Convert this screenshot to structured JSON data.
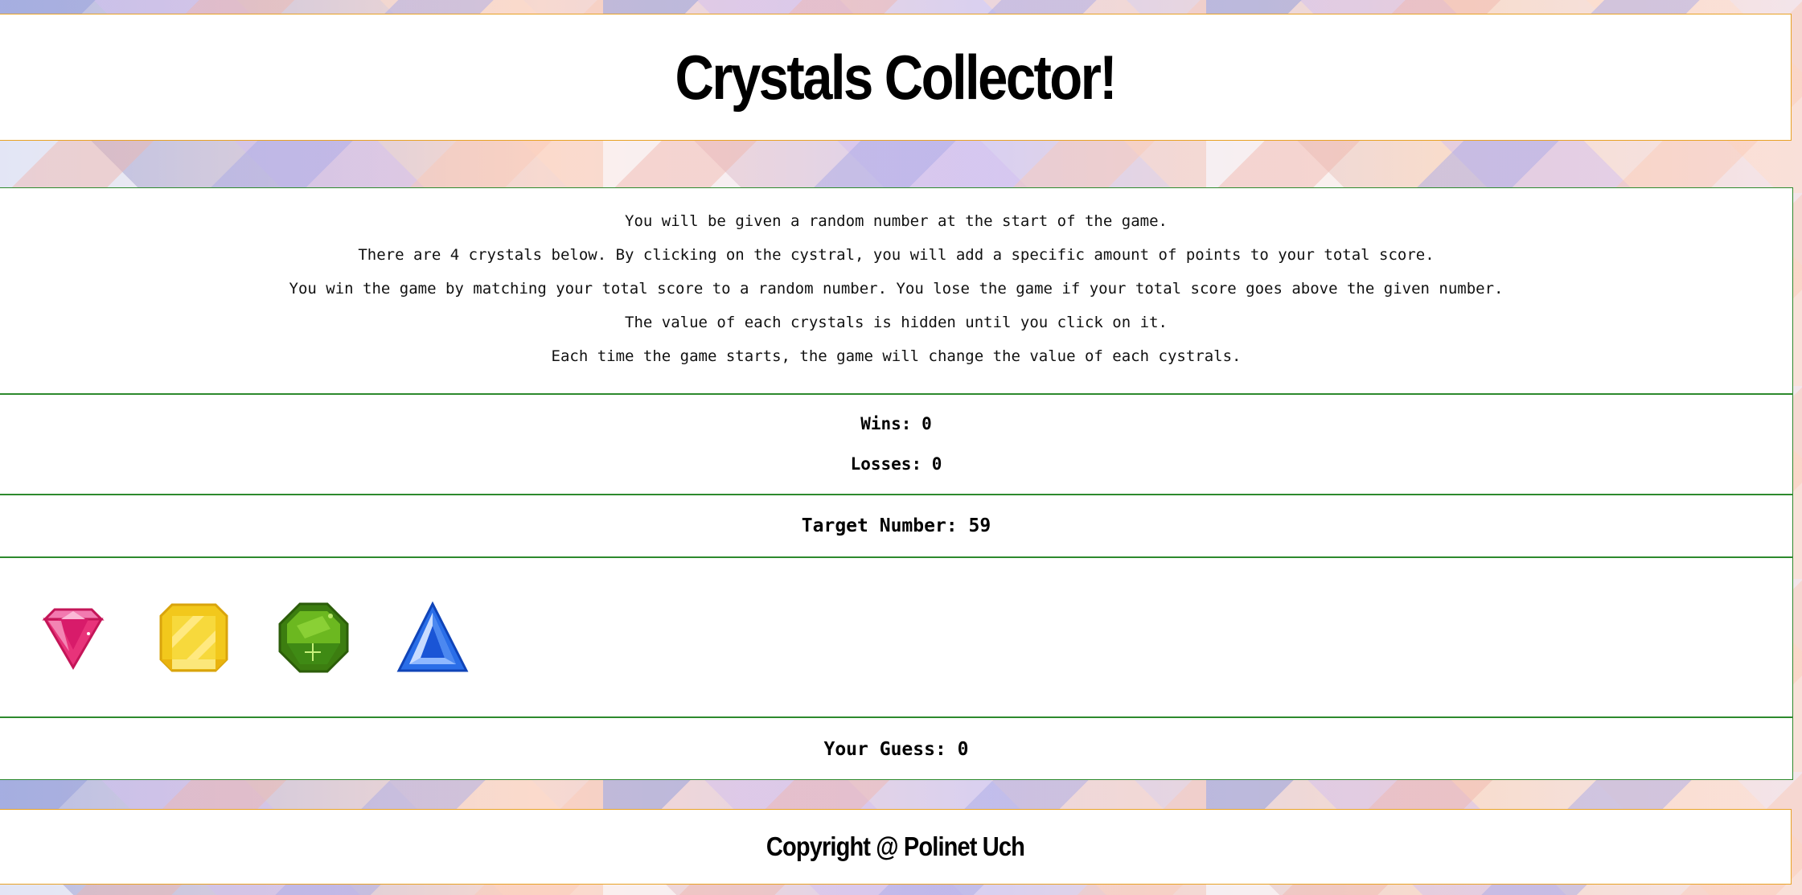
{
  "header": {
    "title": "Crystals Collector!"
  },
  "instructions": [
    "You will be given a random number at the start of the game.",
    "There are 4 crystals below. By clicking on the cystral, you will add a specific amount of points to your total score.",
    "You win the game by matching your total score to a random number. You lose the game if your total score goes above the given number.",
    "The value of each crystals is hidden until you click on it.",
    "Each time the game starts, the game will change the value of each cystrals."
  ],
  "scores": {
    "wins": "Wins: 0",
    "losses": "Losses: 0"
  },
  "target": {
    "label": "Target Number: 59"
  },
  "crystals": [
    {
      "icon": "pink-gem-icon",
      "color": "#e8337a"
    },
    {
      "icon": "yellow-gem-icon",
      "color": "#f2c81c"
    },
    {
      "icon": "green-gem-icon",
      "color": "#4f9a14"
    },
    {
      "icon": "blue-gem-icon",
      "color": "#1f5fe0"
    }
  ],
  "guess": {
    "label": "Your Guess: 0"
  },
  "footer": {
    "copyright": "Copyright @ Polinet Uch"
  },
  "colors": {
    "header_border": "#e8a225",
    "game_border": "#2d8a2d"
  }
}
